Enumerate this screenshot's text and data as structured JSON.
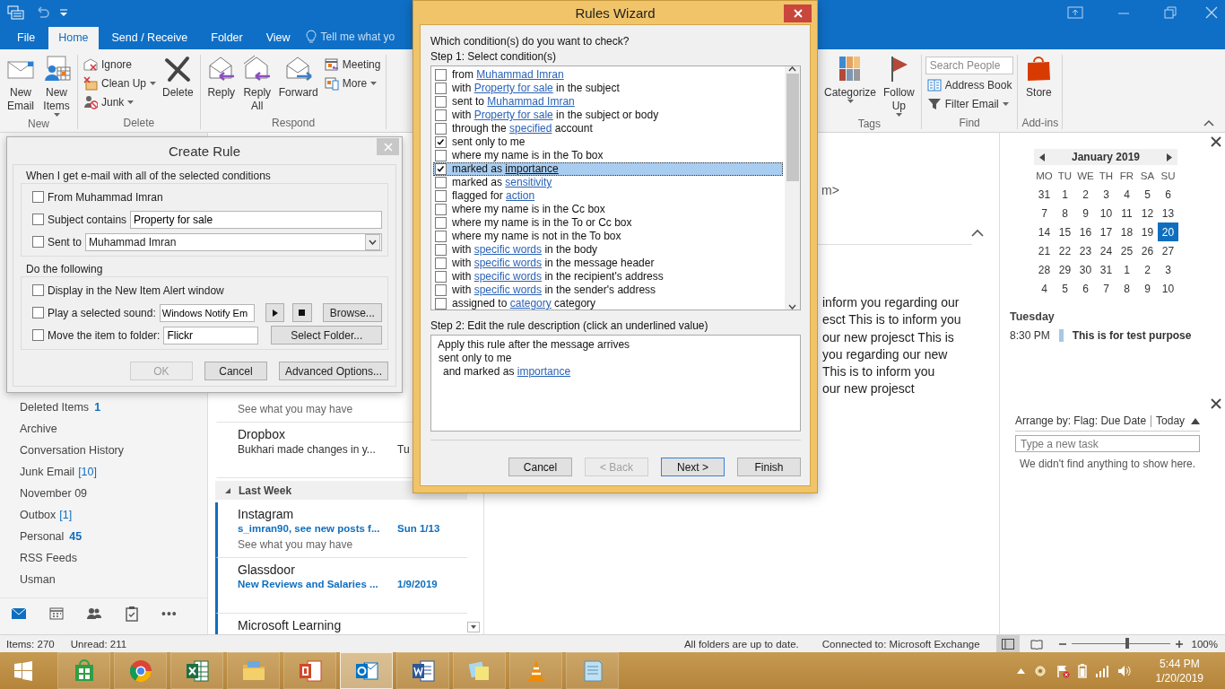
{
  "ribbon": {
    "tabs": [
      {
        "label": "File",
        "selected": false
      },
      {
        "label": "Home",
        "selected": true
      },
      {
        "label": "Send / Receive",
        "selected": false
      },
      {
        "label": "Folder",
        "selected": false
      },
      {
        "label": "View",
        "selected": false
      }
    ],
    "tell_me": "Tell me what yo",
    "groups": [
      {
        "label": "New",
        "buttons": [
          {
            "label": "New Email",
            "kind": "large",
            "dropdown": false
          },
          {
            "label": "New Items",
            "kind": "large",
            "dropdown": true
          }
        ]
      },
      {
        "label": "Delete",
        "buttons": [
          {
            "label": "Ignore",
            "kind": "small",
            "dropdown": false
          },
          {
            "label": "Clean Up",
            "kind": "small",
            "dropdown": true
          },
          {
            "label": "Junk",
            "kind": "small",
            "dropdown": true
          },
          {
            "label": "Delete",
            "kind": "large",
            "dropdown": false
          }
        ]
      },
      {
        "label": "Respond",
        "buttons": [
          {
            "label": "Reply",
            "kind": "large",
            "dropdown": false
          },
          {
            "label": "Reply All",
            "kind": "large",
            "dropdown": false
          },
          {
            "label": "Forward",
            "kind": "large",
            "dropdown": false
          },
          {
            "label": "Meeting",
            "kind": "small",
            "dropdown": false
          },
          {
            "label": "More",
            "kind": "small",
            "dropdown": true
          }
        ]
      },
      {
        "label": "Tags",
        "buttons": [
          {
            "label": "Categorize",
            "kind": "large",
            "dropdown": true
          },
          {
            "label": "Follow Up",
            "kind": "large",
            "dropdown": true
          }
        ]
      },
      {
        "label": "Find",
        "buttons": [
          {
            "placeholder": "Search People",
            "kind": "search"
          },
          {
            "label": "Address Book",
            "kind": "small",
            "dropdown": false
          },
          {
            "label": "Filter Email",
            "kind": "small",
            "dropdown": true
          }
        ]
      },
      {
        "label": "Add-ins",
        "buttons": [
          {
            "label": "Store",
            "kind": "large",
            "dropdown": false
          }
        ]
      }
    ]
  },
  "navigation": {
    "folders": [
      {
        "name": "Deleted Items",
        "count": "1",
        "count_bold": true
      },
      {
        "name": "Archive"
      },
      {
        "name": "Conversation History"
      },
      {
        "name": "Junk Email",
        "count": "[10]",
        "count_bold": false
      },
      {
        "name": "November 09"
      },
      {
        "name": "Outbox",
        "count": "[1]",
        "count_bold": false
      },
      {
        "name": "Personal",
        "count": "45",
        "count_bold": true
      },
      {
        "name": "RSS Feeds"
      },
      {
        "name": "Usman"
      }
    ],
    "modules": [
      {
        "selected": true
      },
      {
        "selected": false
      },
      {
        "selected": false
      },
      {
        "selected": false
      }
    ],
    "more": "•••"
  },
  "messages": [
    {
      "kind": "message",
      "preview": "See what you may have",
      "unread": false
    },
    {
      "kind": "message",
      "sender": "Dropbox",
      "subject": "Bukhari made changes in y...",
      "date": "Tu",
      "unread": false
    },
    {
      "kind": "group",
      "label": "Last Week"
    },
    {
      "kind": "message",
      "sender": "Instagram",
      "subject": "s_imran90, see new posts f...",
      "date": "Sun 1/13",
      "preview": "See what you may have",
      "unread": true
    },
    {
      "kind": "message",
      "sender": "Glassdoor",
      "subject": "New Reviews and Salaries ...",
      "date": "1/9/2019",
      "unread": true
    },
    {
      "kind": "message",
      "sender": "Microsoft Learning",
      "unread": true
    }
  ],
  "reading_pane": {
    "header_fragment": "m>",
    "body_lines": [
      "inform you regarding our",
      "esct This is to inform you",
      "our new projesct This is",
      "you regarding our new",
      "This is to inform you",
      "our new projesct"
    ]
  },
  "todo_bar": {
    "calendar": {
      "month": "January 2019",
      "weekdays": [
        "MO",
        "TU",
        "WE",
        "TH",
        "FR",
        "SA",
        "SU"
      ],
      "days": [
        {
          "day": "31",
          "selected": false
        },
        {
          "day": "1",
          "selected": false
        },
        {
          "day": "2",
          "selected": false
        },
        {
          "day": "3",
          "selected": false
        },
        {
          "day": "4",
          "selected": false
        },
        {
          "day": "5",
          "selected": false
        },
        {
          "day": "6",
          "selected": false
        },
        {
          "day": "7",
          "selected": false
        },
        {
          "day": "8",
          "selected": false
        },
        {
          "day": "9",
          "selected": false
        },
        {
          "day": "10",
          "selected": false
        },
        {
          "day": "11",
          "selected": false
        },
        {
          "day": "12",
          "selected": false
        },
        {
          "day": "13",
          "selected": false
        },
        {
          "day": "14",
          "selected": false
        },
        {
          "day": "15",
          "selected": false
        },
        {
          "day": "16",
          "selected": false
        },
        {
          "day": "17",
          "selected": false
        },
        {
          "day": "18",
          "selected": false
        },
        {
          "day": "19",
          "selected": false
        },
        {
          "day": "20",
          "selected": true
        },
        {
          "day": "21",
          "selected": false
        },
        {
          "day": "22",
          "selected": false
        },
        {
          "day": "23",
          "selected": false
        },
        {
          "day": "24",
          "selected": false
        },
        {
          "day": "25",
          "selected": false
        },
        {
          "day": "26",
          "selected": false
        },
        {
          "day": "27",
          "selected": false
        },
        {
          "day": "28",
          "selected": false
        },
        {
          "day": "29",
          "selected": false
        },
        {
          "day": "30",
          "selected": false
        },
        {
          "day": "31",
          "selected": false
        },
        {
          "day": "1",
          "selected": false
        },
        {
          "day": "2",
          "selected": false
        },
        {
          "day": "3",
          "selected": false
        },
        {
          "day": "4",
          "selected": false
        },
        {
          "day": "5",
          "selected": false
        },
        {
          "day": "6",
          "selected": false
        },
        {
          "day": "7",
          "selected": false
        },
        {
          "day": "8",
          "selected": false
        },
        {
          "day": "9",
          "selected": false
        },
        {
          "day": "10",
          "selected": false
        }
      ]
    },
    "agenda": {
      "day": "Tuesday",
      "items": [
        {
          "time": "8:30 PM",
          "subject": "This is for test purpose"
        }
      ]
    },
    "tasks": {
      "arrange_by": "Arrange by: Flag: Due Date",
      "sort": "Today",
      "placeholder": "Type a new task",
      "empty_message": "We didn't find anything to show here."
    }
  },
  "status_bar": {
    "items": "Items: 270",
    "unread": "Unread: 211",
    "sync": "All folders are up to date.",
    "connection": "Connected to: Microsoft Exchange",
    "zoom": {
      "level": 0.57,
      "reading": "100%"
    }
  },
  "taskbar": {
    "apps": [
      {
        "selected": false
      },
      {
        "selected": false
      },
      {
        "selected": false
      },
      {
        "selected": false
      },
      {
        "selected": false
      },
      {
        "selected": true
      },
      {
        "selected": false
      },
      {
        "selected": false
      },
      {
        "selected": false
      },
      {
        "selected": false
      }
    ],
    "time": "5:44 PM",
    "date": "1/20/2019"
  },
  "create_rule": {
    "title": "Create Rule",
    "conditions_label": "When I get e-mail with all of the selected conditions",
    "conditions": [
      {
        "label": "From Muhammad Imran",
        "checked": false,
        "kind": "plain"
      },
      {
        "label": "Subject contains",
        "checked": false,
        "kind": "text",
        "value": "Property for sale"
      },
      {
        "label": "Sent to",
        "checked": false,
        "kind": "dropdown",
        "value": "Muhammad Imran"
      }
    ],
    "actions_label": "Do the following",
    "actions": [
      {
        "label": "Display in the New Item Alert window",
        "checked": false,
        "kind": "plain"
      },
      {
        "label": "Play a selected sound:",
        "checked": false,
        "kind": "sound",
        "value": "Windows Notify Em",
        "button": "Browse..."
      },
      {
        "label": "Move the item to folder:",
        "checked": false,
        "kind": "folder",
        "value": "Flickr",
        "button": "Select Folder..."
      }
    ],
    "buttons": [
      {
        "label": "OK",
        "disabled": true
      },
      {
        "label": "Cancel",
        "disabled": false
      },
      {
        "label": "Advanced Options...",
        "disabled": false
      }
    ]
  },
  "rules_wizard": {
    "title": "Rules Wizard",
    "question": "Which condition(s) do you want to check?",
    "step1": "Step 1: Select condition(s)",
    "conditions": [
      {
        "checked": false,
        "selected": false,
        "parts": [
          {
            "text": "from ",
            "link": false
          },
          {
            "text": "Muhammad Imran",
            "link": true
          }
        ]
      },
      {
        "checked": false,
        "selected": false,
        "parts": [
          {
            "text": "with ",
            "link": false
          },
          {
            "text": "Property for sale",
            "link": true
          },
          {
            "text": " in the subject",
            "link": false
          }
        ]
      },
      {
        "checked": false,
        "selected": false,
        "parts": [
          {
            "text": "sent to ",
            "link": false
          },
          {
            "text": "Muhammad Imran",
            "link": true
          }
        ]
      },
      {
        "checked": false,
        "selected": false,
        "parts": [
          {
            "text": "with ",
            "link": false
          },
          {
            "text": "Property for sale",
            "link": true
          },
          {
            "text": " in the subject or body",
            "link": false
          }
        ]
      },
      {
        "checked": false,
        "selected": false,
        "parts": [
          {
            "text": "through the ",
            "link": false
          },
          {
            "text": "specified",
            "link": true
          },
          {
            "text": " account",
            "link": false
          }
        ]
      },
      {
        "checked": true,
        "selected": false,
        "parts": [
          {
            "text": "sent only to me",
            "link": false
          }
        ]
      },
      {
        "checked": false,
        "selected": false,
        "parts": [
          {
            "text": "where my name is in the To box",
            "link": false
          }
        ]
      },
      {
        "checked": true,
        "selected": true,
        "parts": [
          {
            "text": "marked as ",
            "link": false
          },
          {
            "text": "importance",
            "link": true
          }
        ]
      },
      {
        "checked": false,
        "selected": false,
        "parts": [
          {
            "text": "marked as ",
            "link": false
          },
          {
            "text": "sensitivity",
            "link": true
          }
        ]
      },
      {
        "checked": false,
        "selected": false,
        "parts": [
          {
            "text": "flagged for ",
            "link": false
          },
          {
            "text": "action",
            "link": true
          }
        ]
      },
      {
        "checked": false,
        "selected": false,
        "parts": [
          {
            "text": "where my name is in the Cc box",
            "link": false
          }
        ]
      },
      {
        "checked": false,
        "selected": false,
        "parts": [
          {
            "text": "where my name is in the To or Cc box",
            "link": false
          }
        ]
      },
      {
        "checked": false,
        "selected": false,
        "parts": [
          {
            "text": "where my name is not in the To box",
            "link": false
          }
        ]
      },
      {
        "checked": false,
        "selected": false,
        "parts": [
          {
            "text": "with ",
            "link": false
          },
          {
            "text": "specific words",
            "link": true
          },
          {
            "text": " in the body",
            "link": false
          }
        ]
      },
      {
        "checked": false,
        "selected": false,
        "parts": [
          {
            "text": "with ",
            "link": false
          },
          {
            "text": "specific words",
            "link": true
          },
          {
            "text": " in the message header",
            "link": false
          }
        ]
      },
      {
        "checked": false,
        "selected": false,
        "parts": [
          {
            "text": "with ",
            "link": false
          },
          {
            "text": "specific words",
            "link": true
          },
          {
            "text": " in the recipient's address",
            "link": false
          }
        ]
      },
      {
        "checked": false,
        "selected": false,
        "parts": [
          {
            "text": "with ",
            "link": false
          },
          {
            "text": "specific words",
            "link": true
          },
          {
            "text": " in the sender's address",
            "link": false
          }
        ]
      },
      {
        "checked": false,
        "selected": false,
        "parts": [
          {
            "text": "assigned to ",
            "link": false
          },
          {
            "text": "category",
            "link": true
          },
          {
            "text": " category",
            "link": false
          }
        ]
      }
    ],
    "step2": "Step 2: Edit the rule description (click an underlined value)",
    "description": [
      {
        "kind": "apply",
        "parts": [
          {
            "text": "Apply this rule after the message arrives",
            "link": false
          }
        ]
      },
      {
        "kind": "condition",
        "parts": [
          {
            "text": "sent only to me",
            "link": false
          }
        ]
      },
      {
        "kind": "and",
        "parts": [
          {
            "text": "and marked as ",
            "link": false
          },
          {
            "text": "importance",
            "link": true
          }
        ]
      }
    ],
    "buttons": [
      {
        "label": "Cancel",
        "disabled": false,
        "default": false
      },
      {
        "label": "< Back",
        "disabled": true,
        "default": false
      },
      {
        "label": "Next >",
        "disabled": false,
        "default": true
      },
      {
        "label": "Finish",
        "disabled": false,
        "default": false
      }
    ]
  }
}
